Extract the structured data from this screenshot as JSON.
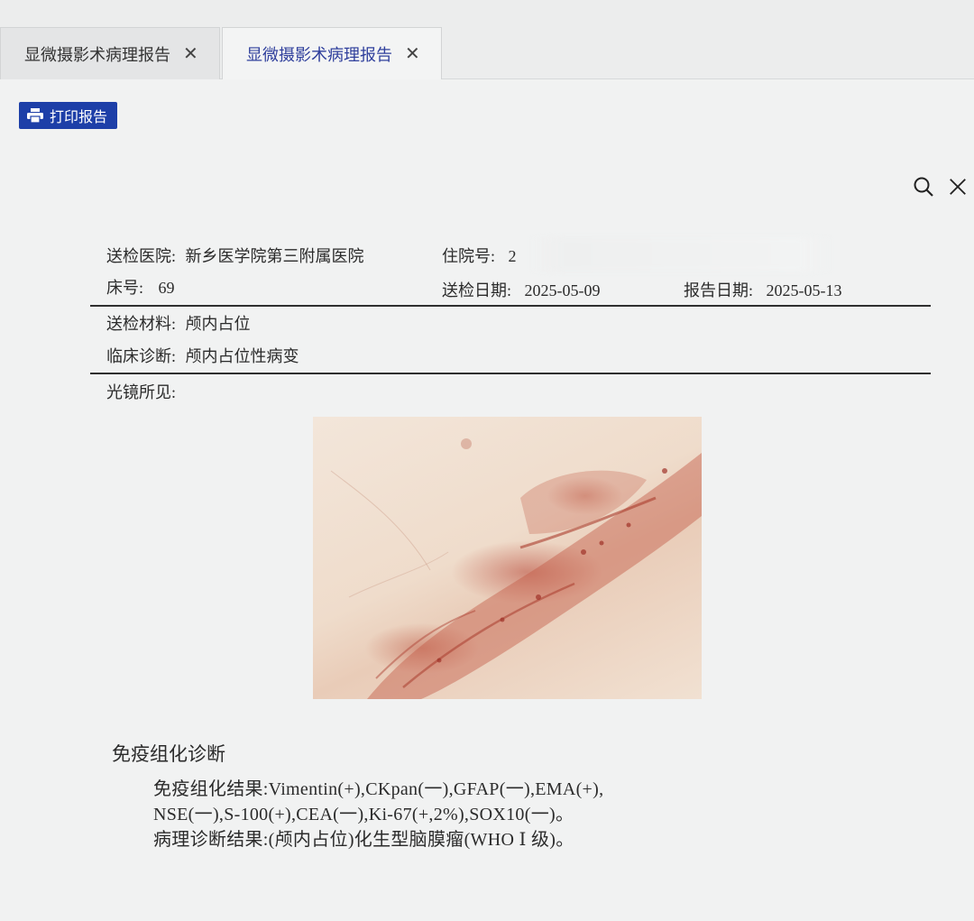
{
  "tabs": [
    {
      "label": "显微摄影术病理报告",
      "active": false
    },
    {
      "label": "显微摄影术病理报告",
      "active": true
    }
  ],
  "toolbar": {
    "print_label": "打印报告"
  },
  "colors": {
    "accent": "#1d3fa8",
    "active_tab_text": "#2f3f9c"
  },
  "icons": {
    "print": "printer-icon",
    "search": "search-icon",
    "close": "close-icon",
    "tab_close": "close-icon"
  },
  "report": {
    "hospital_label": "送检医院:",
    "hospital_value": "新乡医学院第三附属医院",
    "inpatient_label": "住院号:",
    "inpatient_value": "2",
    "bed_label": "床号:",
    "bed_value": "69",
    "submit_date_label": "送检日期:",
    "submit_date_value": "2025-05-09",
    "report_date_label": "报告日期:",
    "report_date_value": "2025-05-13",
    "material_label": "送检材料:",
    "material_value": "颅内占位",
    "clinical_label": "临床诊断:",
    "clinical_value": "颅内占位性病变",
    "microscopy_label": "光镜所见:",
    "ihc_title": "免疫组化诊断",
    "ihc_result_line1": "免疫组化结果:Vimentin(+),CKpan(一),GFAP(一),EMA(+),",
    "ihc_result_line2": "NSE(一),S-100(+),CEA(一),Ki-67(+,2%),SOX10(一)。",
    "diagnosis_line": "病理诊断结果:(颅内占位)化生型脑膜瘤(WHO Ⅰ 级)。"
  }
}
